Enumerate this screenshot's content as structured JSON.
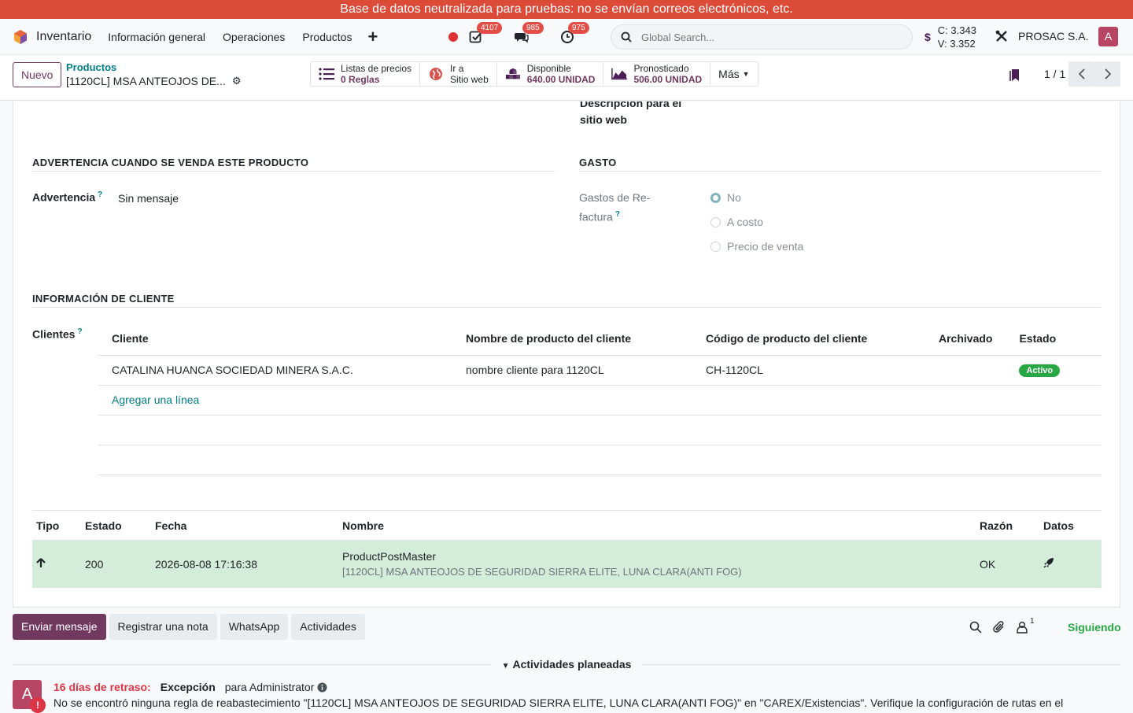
{
  "banner": "Base de datos neutralizada para pruebas: no se envían correos electrónicos, etc.",
  "nav": {
    "app_name": "Inventario",
    "menu": [
      "Información general",
      "Operaciones",
      "Productos"
    ],
    "badges": {
      "activities": "4107",
      "messages": "985",
      "clock": "975"
    },
    "search_placeholder": "Global Search...",
    "currency_c": "C: 3.343",
    "currency_v": "V: 3.352",
    "company": "PROSAC S.A.",
    "avatar": "A"
  },
  "control": {
    "new_button": "Nuevo",
    "breadcrumb_parent": "Productos",
    "breadcrumb_current": "[1120CL] MSA ANTEOJOS DE...",
    "smart_buttons": {
      "pricelists_label": "Listas de precios",
      "pricelists_value": "0",
      "pricelists_unit": "Reglas",
      "website_line1": "Ir a",
      "website_line2": "Sitio web",
      "available_label": "Disponible",
      "available_value": "640.00 UNIDAD",
      "forecast_label": "Pronosticado",
      "forecast_value": "506.00 UNIDAD",
      "more": "Más"
    },
    "pager": "1 / 1"
  },
  "form": {
    "website_desc_line1": "Descripción para el",
    "website_desc_line2": "sitio web",
    "warning_section": "ADVERTENCIA CUANDO SE VENDA ESTE PRODUCTO",
    "warning_label": "Advertencia",
    "warning_value": "Sin mensaje",
    "expense_section": "GASTO",
    "expense_label_line1": "Gastos de Re-",
    "expense_label_line2": "factura",
    "expense_options": [
      "No",
      "A costo",
      "Precio de venta"
    ],
    "customer_section": "INFORMACIÓN DE CLIENTE",
    "customers_label": "Clientes",
    "help_mark": "?",
    "customer_table": {
      "headers": [
        "Cliente",
        "Nombre de producto del cliente",
        "Código de producto del cliente",
        "Archivado",
        "Estado"
      ],
      "rows": [
        {
          "client": "CATALINA HUANCA SOCIEDAD MINERA S.A.C.",
          "name": "nombre cliente para 1120CL",
          "code": "CH-1120CL",
          "archived": "",
          "state": "Activo"
        }
      ],
      "add_line": "Agregar una línea"
    },
    "log_table": {
      "headers": [
        "Tipo",
        "Estado",
        "Fecha",
        "Nombre",
        "Razón",
        "Datos"
      ],
      "rows": [
        {
          "status": "200",
          "date": "2026-08-08 17:16:38",
          "name": "ProductPostMaster",
          "subname": "[1120CL] MSA ANTEOJOS DE SEGURIDAD SIERRA ELITE, LUNA CLARA(ANTI FOG)",
          "reason": "OK"
        }
      ]
    }
  },
  "chatter": {
    "send_message": "Enviar mensaje",
    "log_note": "Registrar una nota",
    "whatsapp": "WhatsApp",
    "activities": "Actividades",
    "followers_count": "1",
    "following": "Siguiendo",
    "planned": "Actividades planeadas",
    "activity": {
      "avatar": "A",
      "late": "16 días de retraso:",
      "type": "Excepción",
      "assignee": "para Administrator",
      "body": "No se encontró ninguna regla de reabastecimiento \"[1120CL] MSA ANTEOJOS DE SEGURIDAD SIERRA ELITE, LUNA CLARA(ANTI FOG)\" en \"CAREX/Existencias\". Verifique la configuración de rutas en el"
    }
  }
}
